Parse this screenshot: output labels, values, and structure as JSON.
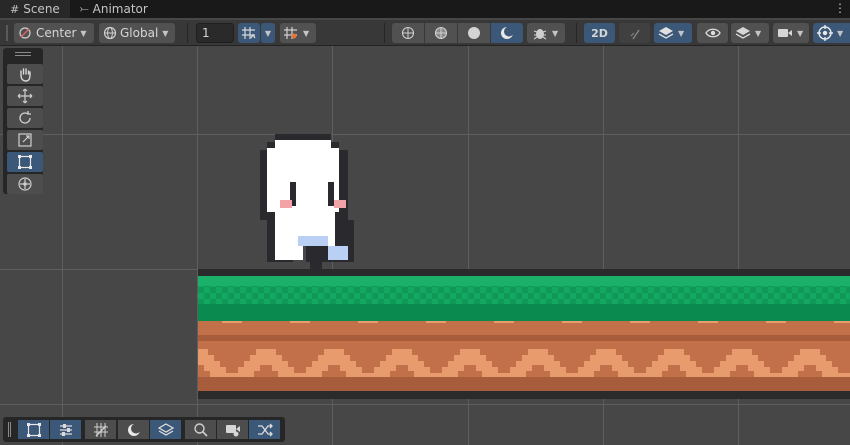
{
  "tabs": [
    {
      "label": "Scene",
      "glyph": "#",
      "active": true
    },
    {
      "label": "Animator",
      "glyph": "⤚",
      "active": false
    }
  ],
  "tab_menu_glyph": "⋮",
  "toolbar": {
    "pivot_mode": "Center",
    "pivot_rotation": "Global",
    "grid_snap_value": "1",
    "view_2d_label": "2D"
  },
  "icons": {
    "tools": [
      "hand-tool-icon",
      "move-tool-icon",
      "rotate-tool-icon",
      "scale-tool-icon",
      "rect-tool-icon",
      "transform-tool-icon"
    ],
    "bottom_tools": [
      "rect-transform-icon",
      "sliders-icon",
      "grid-icon",
      "shading-icon",
      "layers-icon",
      "search-icon",
      "camera-icon",
      "shuffle-icon"
    ]
  },
  "selected_tool": "rect-tool-icon",
  "colors": {
    "accent": "#3c5878",
    "grass": "#15a55f",
    "grass_dark": "#0c8a4c",
    "dirt_light": "#e89c6d",
    "dirt_dark": "#c27049",
    "ground_edge": "#2b2b2b"
  }
}
